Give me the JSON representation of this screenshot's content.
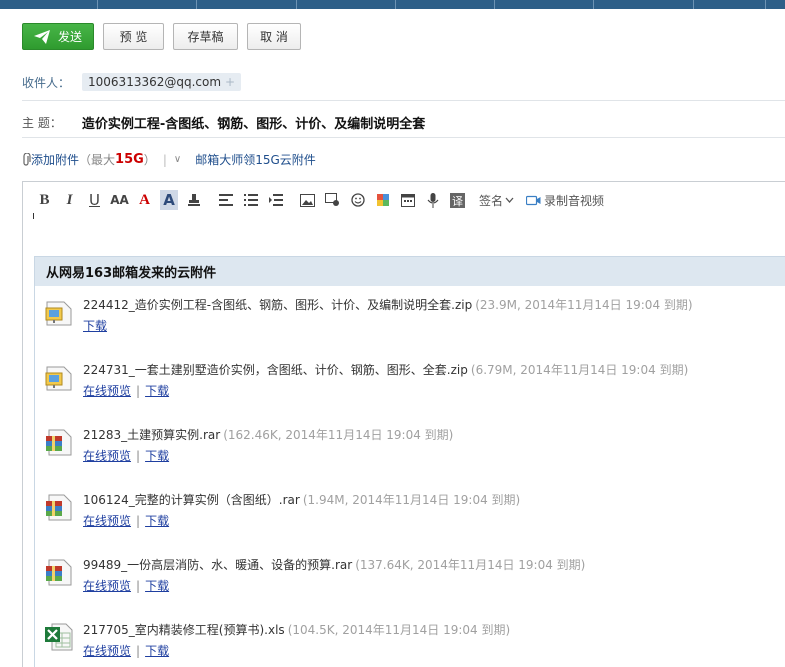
{
  "toolbar": {
    "send": "发送",
    "preview": "预 览",
    "draft": "存草稿",
    "cancel": "取 消"
  },
  "recipient": {
    "label": "收件人：",
    "email": "1006313362@qq.com",
    "chip_plus": "+"
  },
  "subject": {
    "label": "主 题：",
    "value": "造价实例工程-含图纸、钢筋、图形、计价、及编制说明全套"
  },
  "attach": {
    "add_label": "添加附件",
    "max_prefix": "（最大",
    "max_size": "15G",
    "max_suffix": "）",
    "divider": "|",
    "chevron": "∨",
    "cloud_link": "邮箱大师领15G云附件"
  },
  "editor_toolbar": {
    "bold": "B",
    "italic": "I",
    "underline": "U",
    "font_size": "AA",
    "font_color": "A",
    "bg_color": "A",
    "signature": "签名",
    "record": "录制音视频"
  },
  "cloud": {
    "title": "从网易163邮箱发来的云附件",
    "files": [
      {
        "name": "224412_造价实例工程-含图纸、钢筋、图形、计价、及编制说明全套.zip",
        "meta": "(23.9M, 2014年11月14日  19:04 到期)",
        "type": "zip",
        "preview": "",
        "download": "下载"
      },
      {
        "name": "224731_一套土建别墅造价实例，含图纸、计价、钢筋、图形、全套.zip",
        "meta": "(6.79M, 2014年11月14日  19:04 到期)",
        "type": "zip",
        "preview": "在线预览",
        "download": "下载"
      },
      {
        "name": "21283_土建预算实例.rar",
        "meta": "(162.46K, 2014年11月14日  19:04 到期)",
        "type": "rar",
        "preview": "在线预览",
        "download": "下载"
      },
      {
        "name": "106124_完整的计算实例（含图纸）.rar",
        "meta": "(1.94M, 2014年11月14日  19:04 到期)",
        "type": "rar",
        "preview": "在线预览",
        "download": "下载"
      },
      {
        "name": "99489_一份高层消防、水、暖通、设备的预算.rar",
        "meta": "(137.64K, 2014年11月14日  19:04 到期)",
        "type": "rar",
        "preview": "在线预览",
        "download": "下载"
      },
      {
        "name": "217705_室内精装修工程(预算书).xls",
        "meta": "(104.5K, 2014年11月14日  19:04 到期)",
        "type": "xls",
        "preview": "在线预览",
        "download": "下载"
      }
    ]
  },
  "colors": {
    "send_green": "#3aa83a",
    "link_blue": "#1f3fa0",
    "header_bg": "#dde7f0",
    "top_strip": "#2e5f88"
  }
}
